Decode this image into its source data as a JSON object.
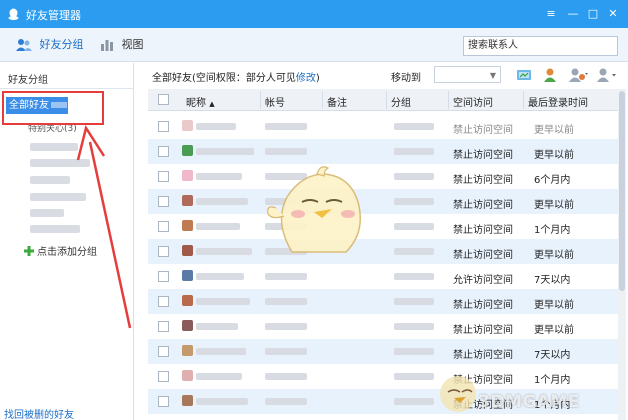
{
  "window": {
    "title": "好友管理器",
    "controls": [
      "≡",
      "—",
      "□",
      "✕"
    ]
  },
  "toolbar": {
    "friends_group_label": "好友分组",
    "view_label": "视图",
    "search_placeholder": "搜索联系人"
  },
  "sidebar": {
    "heading": "好友分组",
    "all_friends_label": "全部好友",
    "special_label": "特别关心(3)",
    "add_group_label": "点击添加分组",
    "recover_label": "找回被删的好友"
  },
  "main": {
    "header_label": "全部好友(空间权限：部分人可见",
    "header_edit": "修改",
    "header_close": ")",
    "move_to_label": "移动到"
  },
  "table": {
    "columns": [
      "昵称",
      "帐号",
      "备注",
      "分组",
      "空间访问",
      "最后登录时间"
    ],
    "sort_indicator": "▲",
    "rows": [
      {
        "space": "禁止访问空间",
        "last_login": "更早以前",
        "faded": true
      },
      {
        "space": "禁止访问空间",
        "last_login": "更早以前",
        "faded": false
      },
      {
        "space": "禁止访问空间",
        "last_login": "6个月内",
        "faded": false
      },
      {
        "space": "禁止访问空间",
        "last_login": "更早以前",
        "faded": false
      },
      {
        "space": "禁止访问空间",
        "last_login": "1个月内",
        "faded": false
      },
      {
        "space": "禁止访问空间",
        "last_login": "更早以前",
        "faded": false
      },
      {
        "space": "允许访问空间",
        "last_login": "7天以内",
        "faded": false
      },
      {
        "space": "禁止访问空间",
        "last_login": "更早以前",
        "faded": false
      },
      {
        "space": "禁止访问空间",
        "last_login": "更早以前",
        "faded": false
      },
      {
        "space": "禁止访问空间",
        "last_login": "7天以内",
        "faded": false
      },
      {
        "space": "禁止访问空间",
        "last_login": "1个月内",
        "faded": false
      },
      {
        "space": "禁止访问空间",
        "last_login": "1个月内",
        "faded": false
      }
    ]
  },
  "watermark": {
    "text": "3DMGAME"
  },
  "colors": {
    "titlebar": "#2b9cf0",
    "accent": "#3b8ee8",
    "annotation": "#e53c3c",
    "row_alt": "#e8f2fd"
  },
  "icons": [
    "qq-penguin-icon",
    "friends-group-icon",
    "view-chart-icon",
    "add-friend-icon",
    "send-message-icon",
    "settings-icon",
    "plus-icon",
    "mascot-icon"
  ]
}
